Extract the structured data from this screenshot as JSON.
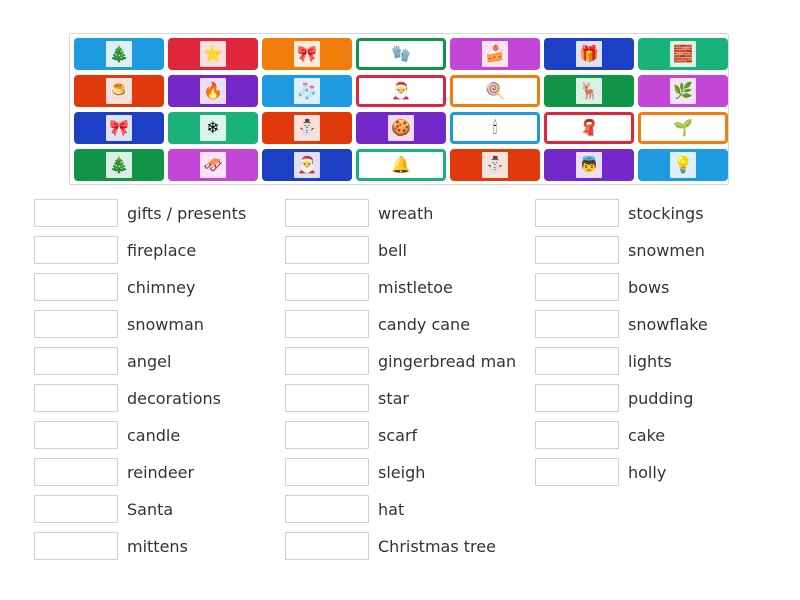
{
  "tiles": [
    {
      "bg": "#1e9be0",
      "outline": false,
      "icon": "christmas-tree-icon",
      "glyph": "🎄"
    },
    {
      "bg": "#e0263b",
      "outline": false,
      "icon": "star-icon",
      "glyph": "⭐"
    },
    {
      "bg": "#f07c0c",
      "outline": false,
      "icon": "decorations-icon",
      "glyph": "🎀"
    },
    {
      "bg": "#119447",
      "outline": true,
      "icon": "mittens-icon",
      "glyph": "🧤"
    },
    {
      "bg": "#c247d6",
      "outline": false,
      "icon": "cake-icon",
      "glyph": "🍰"
    },
    {
      "bg": "#1c3fc4",
      "outline": false,
      "icon": "gifts-icon",
      "glyph": "🎁"
    },
    {
      "bg": "#19b27b",
      "outline": false,
      "icon": "chimney-icon",
      "glyph": "🧱"
    },
    {
      "bg": "#e03a0c",
      "outline": false,
      "icon": "pudding-icon",
      "glyph": "🍮"
    },
    {
      "bg": "#7528c9",
      "outline": false,
      "icon": "fireplace-icon",
      "glyph": "🔥"
    },
    {
      "bg": "#1e9be0",
      "outline": false,
      "icon": "stockings-icon",
      "glyph": "🧦"
    },
    {
      "bg": "#e0263b",
      "outline": true,
      "icon": "hat-icon",
      "glyph": "🎅"
    },
    {
      "bg": "#f07c0c",
      "outline": true,
      "icon": "candy-cane-icon",
      "glyph": "🍭"
    },
    {
      "bg": "#119447",
      "outline": false,
      "icon": "reindeer-icon",
      "glyph": "🦌"
    },
    {
      "bg": "#c247d6",
      "outline": false,
      "icon": "holly-icon",
      "glyph": "🌿"
    },
    {
      "bg": "#1c3fc4",
      "outline": false,
      "icon": "bows-icon",
      "glyph": "🎀"
    },
    {
      "bg": "#19b27b",
      "outline": false,
      "icon": "snowflake-icon",
      "glyph": "❄"
    },
    {
      "bg": "#e03a0c",
      "outline": false,
      "icon": "snowmen-icon",
      "glyph": "⛄"
    },
    {
      "bg": "#7528c9",
      "outline": false,
      "icon": "gingerbread-man-icon",
      "glyph": "🍪"
    },
    {
      "bg": "#1e9be0",
      "outline": true,
      "icon": "candle-icon",
      "glyph": "🕯"
    },
    {
      "bg": "#e0263b",
      "outline": true,
      "icon": "scarf-icon",
      "glyph": "🧣"
    },
    {
      "bg": "#f07c0c",
      "outline": true,
      "icon": "mistletoe-icon",
      "glyph": "🌱"
    },
    {
      "bg": "#119447",
      "outline": false,
      "icon": "wreath-icon",
      "glyph": "🎄"
    },
    {
      "bg": "#c247d6",
      "outline": false,
      "icon": "sleigh-icon",
      "glyph": "🛷"
    },
    {
      "bg": "#1c3fc4",
      "outline": false,
      "icon": "santa-icon",
      "glyph": "🎅"
    },
    {
      "bg": "#19b27b",
      "outline": true,
      "icon": "bell-icon",
      "glyph": "🔔"
    },
    {
      "bg": "#e03a0c",
      "outline": false,
      "icon": "snowman-icon",
      "glyph": "⛄"
    },
    {
      "bg": "#7528c9",
      "outline": false,
      "icon": "angel-icon",
      "glyph": "👼"
    },
    {
      "bg": "#1e9be0",
      "outline": false,
      "icon": "lights-icon",
      "glyph": "💡"
    }
  ],
  "words": {
    "col1": [
      "gifts / presents",
      "fireplace",
      "chimney",
      "snowman",
      "angel",
      "decorations",
      "candle",
      "reindeer",
      "Santa",
      "mittens"
    ],
    "col2": [
      "wreath",
      "bell",
      "mistletoe",
      "candy cane",
      "gingerbread man",
      "star",
      "scarf",
      "sleigh",
      "hat",
      "Christmas tree"
    ],
    "col3": [
      "stockings",
      "snowmen",
      "bows",
      "snowflake",
      "lights",
      "pudding",
      "cake",
      "holly"
    ]
  }
}
